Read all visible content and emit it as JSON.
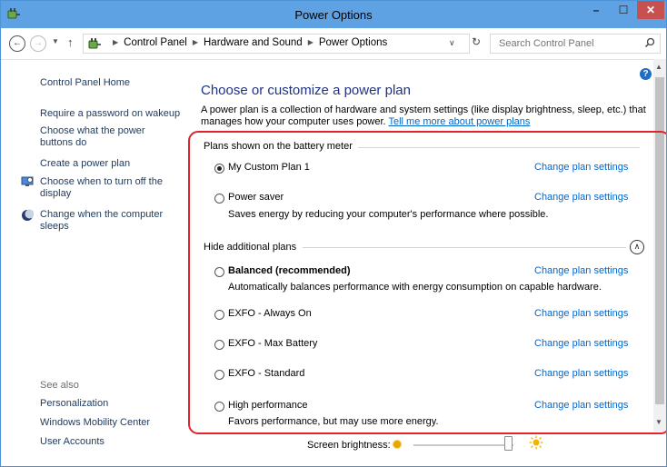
{
  "window": {
    "title": "Power Options",
    "title_bar_color": "#5ea2e4",
    "buttons": {
      "minimize": "–",
      "maximize": "☐",
      "close": "✕"
    }
  },
  "address_bar": {
    "breadcrumbs": [
      "Control Panel",
      "Hardware and Sound",
      "Power Options"
    ],
    "search_placeholder": "Search Control Panel"
  },
  "sidebar": {
    "home_link": "Control Panel Home",
    "links": [
      {
        "label": "Require a password on wakeup",
        "icon": null
      },
      {
        "label": "Choose what the power buttons do",
        "icon": null
      },
      {
        "label": "Create a power plan",
        "icon": null
      },
      {
        "label": "Choose when to turn off the display",
        "icon": "monitor-icon"
      },
      {
        "label": "Change when the computer sleeps",
        "icon": "moon-icon"
      }
    ],
    "see_also_label": "See also",
    "see_also": [
      "Personalization",
      "Windows Mobility Center",
      "User Accounts"
    ]
  },
  "main": {
    "heading": "Choose or customize a power plan",
    "intro": "A power plan is a collection of hardware and system settings (like display brightness, sleep, etc.) that manages how your computer uses power.",
    "intro_link": "Tell me more about power plans",
    "battery_meter_label": "Plans shown on the battery meter",
    "hide_plans_label": "Hide additional plans",
    "change_settings_label": "Change plan settings",
    "plans_battery": [
      {
        "name": "My Custom Plan 1",
        "selected": true,
        "description": ""
      },
      {
        "name": "Power saver",
        "selected": false,
        "description": "Saves energy by reducing your computer's performance where possible."
      }
    ],
    "plans_additional": [
      {
        "name": "Balanced (recommended)",
        "selected": false,
        "bold": true,
        "description": "Automatically balances performance with energy consumption on capable hardware."
      },
      {
        "name": "EXFO - Always On",
        "selected": false,
        "description": ""
      },
      {
        "name": "EXFO - Max Battery",
        "selected": false,
        "description": ""
      },
      {
        "name": "EXFO - Standard",
        "selected": false,
        "description": ""
      },
      {
        "name": "High performance",
        "selected": false,
        "description": "Favors performance, but may use more energy."
      }
    ]
  },
  "footer": {
    "brightness_label": "Screen brightness:",
    "brightness_level_percent": 95
  },
  "highlight_color": "#e0242b"
}
